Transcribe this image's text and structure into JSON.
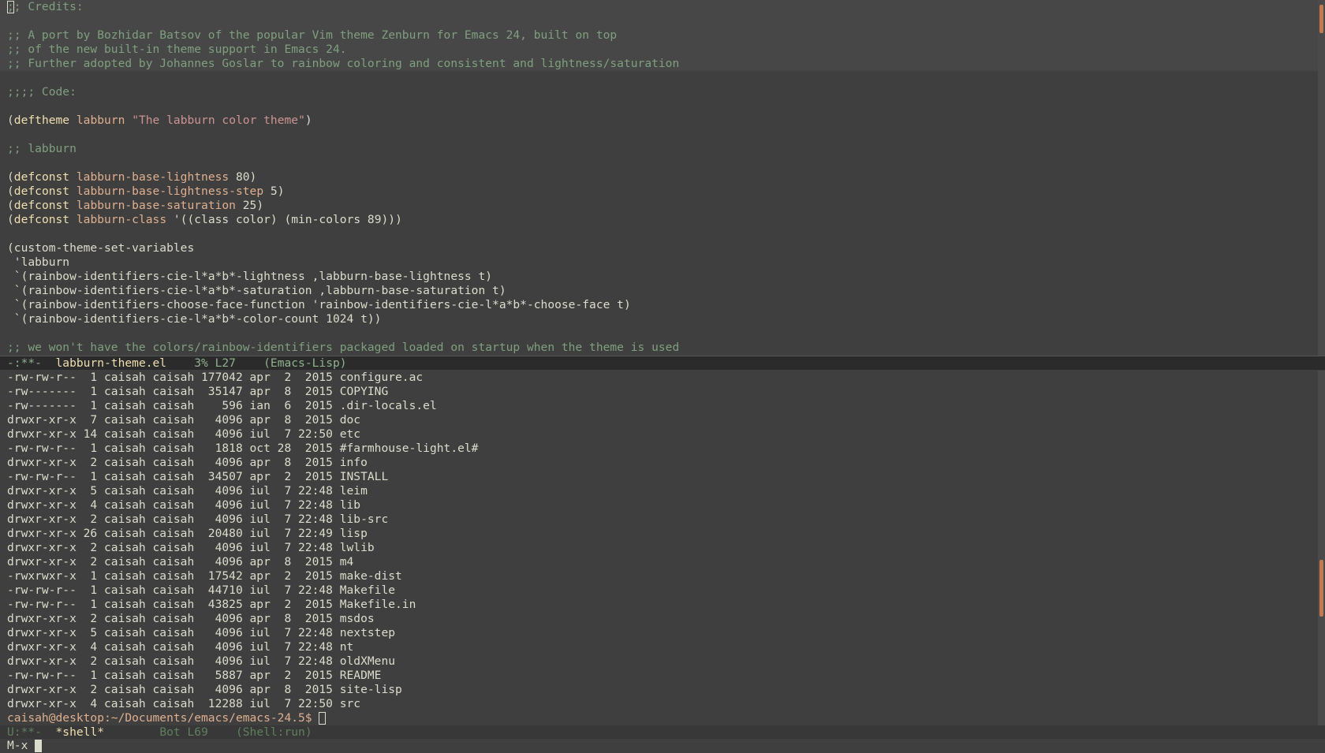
{
  "editor": {
    "lines": [
      {
        "cls": "comment hl",
        "text": ";; Credits:",
        "cursor": true
      },
      {
        "cls": "comment hl",
        "text": ""
      },
      {
        "cls": "comment hl",
        "text": ";; A port by Bozhidar Batsov of the popular Vim theme Zenburn for Emacs 24, built on top"
      },
      {
        "cls": "comment hl",
        "text": ";; of the new built-in theme support in Emacs 24."
      },
      {
        "cls": "comment hl",
        "text": ";; Further adopted by Johannes Goslar to rainbow coloring and consistent and lightness/saturation"
      },
      {
        "cls": "plain",
        "text": ""
      },
      {
        "cls": "comment",
        "text": ";;;; Code:"
      },
      {
        "cls": "plain",
        "text": ""
      },
      {
        "segs": [
          [
            "paren",
            "("
          ],
          [
            "kw",
            "deftheme"
          ],
          [
            "plain",
            " "
          ],
          [
            "var",
            "labburn"
          ],
          [
            "plain",
            " "
          ],
          [
            "str",
            "\"The labburn color theme\""
          ],
          [
            "paren",
            ")"
          ]
        ]
      },
      {
        "cls": "plain",
        "text": ""
      },
      {
        "cls": "comment",
        "text": ";; labburn"
      },
      {
        "cls": "plain",
        "text": ""
      },
      {
        "segs": [
          [
            "paren",
            "("
          ],
          [
            "kw",
            "defconst"
          ],
          [
            "plain",
            " "
          ],
          [
            "var",
            "labburn-base-lightness"
          ],
          [
            "plain",
            " 80)"
          ]
        ]
      },
      {
        "segs": [
          [
            "paren",
            "("
          ],
          [
            "kw",
            "defconst"
          ],
          [
            "plain",
            " "
          ],
          [
            "var",
            "labburn-base-lightness-step"
          ],
          [
            "plain",
            " 5)"
          ]
        ]
      },
      {
        "segs": [
          [
            "paren",
            "("
          ],
          [
            "kw",
            "defconst"
          ],
          [
            "plain",
            " "
          ],
          [
            "var",
            "labburn-base-saturation"
          ],
          [
            "plain",
            " 25)"
          ]
        ]
      },
      {
        "segs": [
          [
            "paren",
            "("
          ],
          [
            "kw",
            "defconst"
          ],
          [
            "plain",
            " "
          ],
          [
            "var",
            "labburn-class"
          ],
          [
            "plain",
            " '((class color) (min-colors 89)))"
          ]
        ]
      },
      {
        "cls": "plain",
        "text": ""
      },
      {
        "cls": "plain",
        "text": "(custom-theme-set-variables"
      },
      {
        "cls": "plain",
        "text": " 'labburn"
      },
      {
        "cls": "plain",
        "text": " `(rainbow-identifiers-cie-l*a*b*-lightness ,labburn-base-lightness t)"
      },
      {
        "cls": "plain",
        "text": " `(rainbow-identifiers-cie-l*a*b*-saturation ,labburn-base-saturation t)"
      },
      {
        "cls": "plain",
        "text": " `(rainbow-identifiers-choose-face-function 'rainbow-identifiers-cie-l*a*b*-choose-face t)"
      },
      {
        "cls": "plain",
        "text": " `(rainbow-identifiers-cie-l*a*b*-color-count 1024 t))"
      },
      {
        "cls": "plain",
        "text": ""
      },
      {
        "cls": "comment",
        "text": ";; we won't have the colors/rainbow-identifiers packaged loaded on startup when the theme is used"
      }
    ]
  },
  "modeline_top": {
    "status": "-:**-  ",
    "buffer": "labburn-theme.el",
    "position": "    3% L27    ",
    "mode": "(Emacs-Lisp)"
  },
  "shell": {
    "lines": [
      "-rw-rw-r--  1 caisah caisah 177042 apr  2  2015 configure.ac",
      "-rw-------  1 caisah caisah  35147 apr  8  2015 COPYING",
      "-rw-------  1 caisah caisah    596 ian  6  2015 .dir-locals.el",
      "drwxr-xr-x  7 caisah caisah   4096 apr  8  2015 doc",
      "drwxr-xr-x 14 caisah caisah   4096 iul  7 22:50 etc",
      "-rw-rw-r--  1 caisah caisah   1818 oct 28  2015 #farmhouse-light.el#",
      "drwxr-xr-x  2 caisah caisah   4096 apr  8  2015 info",
      "-rw-rw-r--  1 caisah caisah  34507 apr  2  2015 INSTALL",
      "drwxr-xr-x  5 caisah caisah   4096 iul  7 22:48 leim",
      "drwxr-xr-x  4 caisah caisah   4096 iul  7 22:48 lib",
      "drwxr-xr-x  2 caisah caisah   4096 iul  7 22:48 lib-src",
      "drwxr-xr-x 26 caisah caisah  20480 iul  7 22:49 lisp",
      "drwxr-xr-x  2 caisah caisah   4096 iul  7 22:48 lwlib",
      "drwxr-xr-x  2 caisah caisah   4096 apr  8  2015 m4",
      "-rwxrwxr-x  1 caisah caisah  17542 apr  2  2015 make-dist",
      "-rw-rw-r--  1 caisah caisah  44710 iul  7 22:48 Makefile",
      "-rw-rw-r--  1 caisah caisah  43825 apr  2  2015 Makefile.in",
      "drwxr-xr-x  2 caisah caisah   4096 apr  8  2015 msdos",
      "drwxr-xr-x  5 caisah caisah   4096 iul  7 22:48 nextstep",
      "drwxr-xr-x  4 caisah caisah   4096 iul  7 22:48 nt",
      "drwxr-xr-x  2 caisah caisah   4096 iul  7 22:48 oldXMenu",
      "-rw-rw-r--  1 caisah caisah   5887 apr  2  2015 README",
      "drwxr-xr-x  2 caisah caisah   4096 apr  8  2015 site-lisp",
      "drwxr-xr-x  4 caisah caisah  12288 iul  7 22:50 src"
    ],
    "prompt": "caisah@desktop:~/Documents/emacs/emacs-24.5$ "
  },
  "modeline_bottom": {
    "status": "U:**-  ",
    "buffer": "*shell*",
    "position": "        Bot L69    ",
    "mode": "(Shell:run)"
  },
  "minibuffer": {
    "text": "M-x "
  },
  "colors": {
    "bg": "#3f3f3f",
    "comment": "#7f9f7f",
    "keyword": "#f0dfaf",
    "variable": "#dfaf8f",
    "string": "#cc9393",
    "fg": "#dcdccc"
  }
}
